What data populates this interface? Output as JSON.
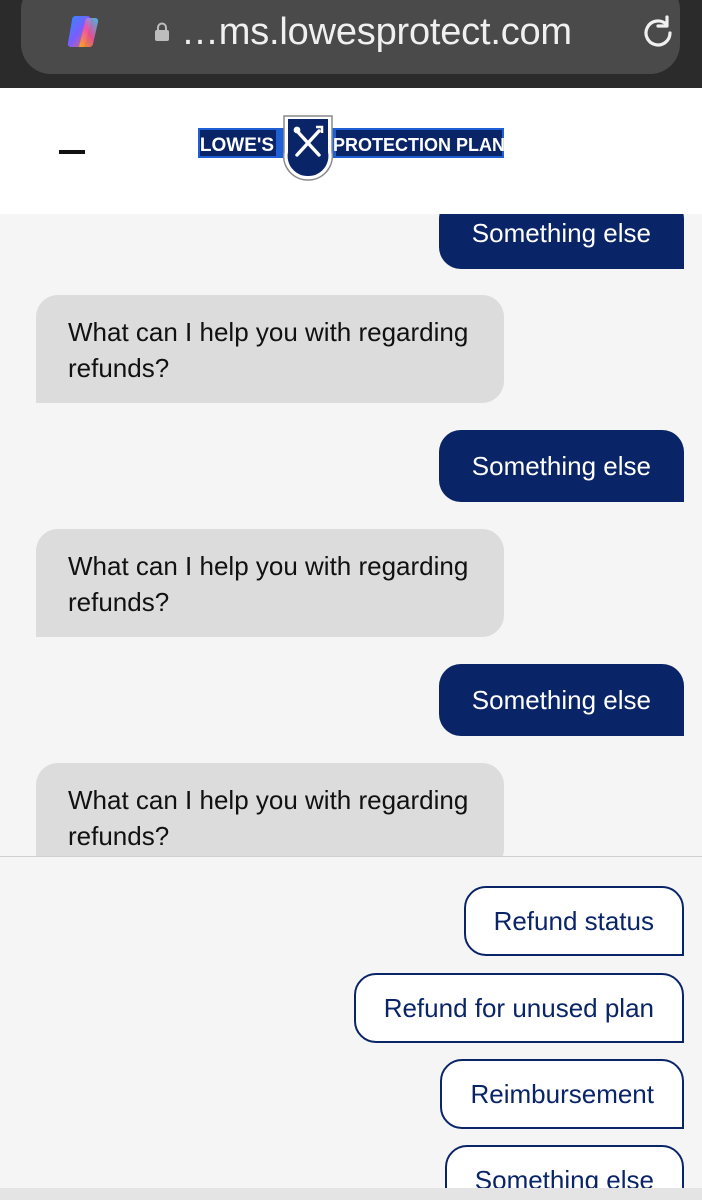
{
  "browser": {
    "url": "…ms.lowesprotect.com",
    "icons": [
      "copilot-icon",
      "lock-icon",
      "reload-icon"
    ]
  },
  "header": {
    "logo_left": "LOWE'S",
    "logo_right": "PROTECTION PLAN",
    "menu_icon": "minus-icon"
  },
  "colors": {
    "brand_navy": "#0a2468",
    "brand_blue": "#1f5fd6",
    "bot_bubble": "#dcdcdc",
    "background": "#f5f5f5"
  },
  "messages": [
    {
      "role": "user",
      "text": "Something else"
    },
    {
      "role": "bot",
      "text": "What can I help you with regarding refunds?"
    },
    {
      "role": "user",
      "text": "Something else"
    },
    {
      "role": "bot",
      "text": "What can I help you with regarding refunds?"
    },
    {
      "role": "user",
      "text": "Something else"
    },
    {
      "role": "bot",
      "text": "What can I help you with regarding refunds?"
    }
  ],
  "quick_replies": [
    "Refund status",
    "Refund for unused plan",
    "Reimbursement",
    "Something else"
  ]
}
